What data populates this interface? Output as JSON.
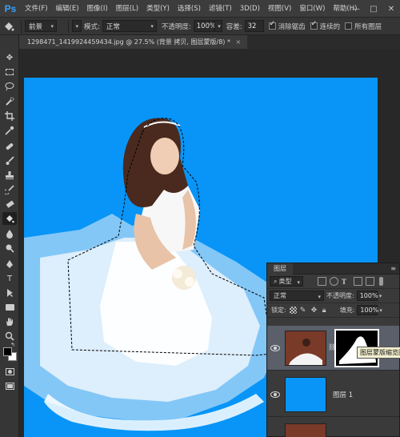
{
  "app": {
    "logo": "Ps"
  },
  "menu": [
    "文件(F)",
    "编辑(E)",
    "图像(I)",
    "图层(L)",
    "类型(Y)",
    "选择(S)",
    "滤镜(T)",
    "3D(D)",
    "视图(V)",
    "窗口(W)",
    "帮助(H)"
  ],
  "window_controls": [
    "—",
    "□",
    "✕"
  ],
  "options": {
    "preset_label": "前景",
    "mode_label": "模式:",
    "mode_value": "正常",
    "opacity_label": "不透明度:",
    "opacity_value": "100%",
    "tolerance_label": "容差:",
    "tolerance_value": "32",
    "antialias_label": "消除锯齿",
    "antialias_checked": true,
    "contiguous_label": "连续的",
    "contiguous_checked": true,
    "all_layers_label": "所有图层",
    "all_layers_checked": false
  },
  "document": {
    "tab_title": "1298471_1419924459434.jpg @ 27.5% (背景 拷贝, 图层蒙版/8) *",
    "close": "×"
  },
  "colors": {
    "canvas_bg": "#0895f7",
    "app_bg": "#282828",
    "panel": "#3a3a3a",
    "brand": "#3aa0ff"
  },
  "tools": [
    "move-tool",
    "marquee-tool",
    "lasso-tool",
    "quick-select-tool",
    "crop-tool",
    "eyedropper-tool",
    "healing-brush-tool",
    "brush-tool",
    "clone-stamp-tool",
    "history-brush-tool",
    "eraser-tool",
    "paint-bucket-tool",
    "blur-tool",
    "dodge-tool",
    "pen-tool",
    "type-tool",
    "path-select-tool",
    "shape-tool",
    "hand-tool",
    "zoom-tool"
  ],
  "layers_panel": {
    "title": "图层",
    "filter_label": "类型",
    "blend_mode": "正常",
    "opacity_label": "不透明度:",
    "opacity_value": "100%",
    "lock_label": "锁定:",
    "fill_label": "填充:",
    "fill_value": "100%",
    "layers": [
      {
        "name": "",
        "tooltip": "图层蒙版缩览图",
        "visible": true,
        "has_mask": true
      },
      {
        "name": "图层 1",
        "visible": true,
        "has_mask": false
      },
      {
        "name": "",
        "visible": true,
        "has_mask": false
      }
    ]
  }
}
